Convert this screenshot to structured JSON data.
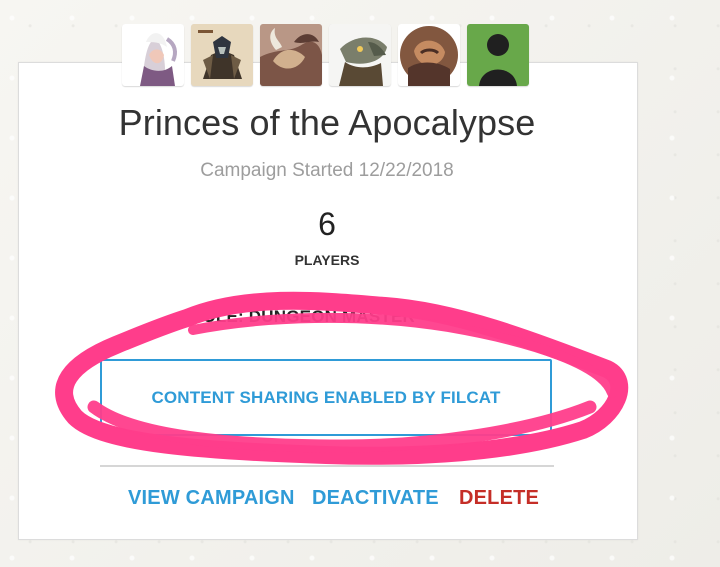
{
  "campaign": {
    "title": "Princes of the Apocalypse",
    "started": "Campaign Started 12/22/2018",
    "player_count": "6",
    "players_label": "PLAYERS",
    "role_text": "ROLE: DUNGEON MASTER"
  },
  "avatars": [
    {
      "icon": "avatar-elf-portrait"
    },
    {
      "icon": "avatar-dragonborn-portrait"
    },
    {
      "icon": "avatar-beast-portrait"
    },
    {
      "icon": "avatar-lizard-portrait"
    },
    {
      "icon": "avatar-orc-portrait"
    },
    {
      "icon": "avatar-silhouette"
    }
  ],
  "buttons": {
    "content_sharing": "CONTENT SHARING ENABLED BY FILCAT"
  },
  "actions": {
    "view_campaign": "VIEW CAMPAIGN",
    "deactivate": "DEACTIVATE",
    "delete": "DELETE"
  },
  "colors": {
    "link_blue": "#2f9bd7",
    "delete_red": "#c52e27",
    "highlight_pink": "#ff3d8b"
  }
}
